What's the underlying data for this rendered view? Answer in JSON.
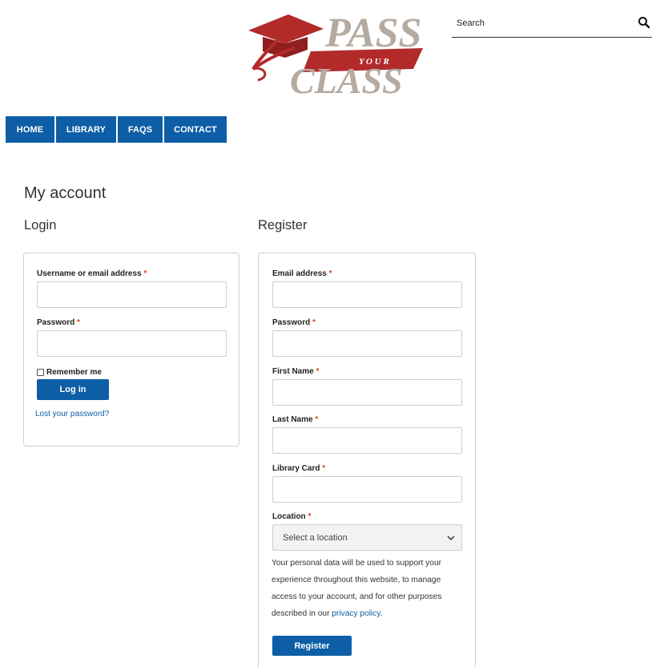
{
  "logo": {
    "line1": "PASS",
    "line2": "Y O U R",
    "line3": "CLASS"
  },
  "search": {
    "placeholder": "Search",
    "icon": "search-icon"
  },
  "nav": {
    "items": [
      {
        "label": "HOME"
      },
      {
        "label": "LIBRARY"
      },
      {
        "label": "FAQS"
      },
      {
        "label": "CONTACT"
      }
    ]
  },
  "page": {
    "title": "My account"
  },
  "login": {
    "heading": "Login",
    "username_label": "Username or email address",
    "password_label": "Password",
    "required_mark": "*",
    "remember_label": "Remember me",
    "login_button": "Log in",
    "lost_password": "Lost your password?"
  },
  "register": {
    "heading": "Register",
    "email_label": "Email address",
    "password_label": "Password",
    "first_name_label": "First Name",
    "last_name_label": "Last Name",
    "library_card_label": "Library Card",
    "location_label": "Location",
    "required_mark": "*",
    "location_placeholder": "Select a location",
    "privacy_text": "Your personal data will be used to support your experience throughout this website, to manage access to your account, and for other purposes described in our ",
    "privacy_link": "privacy policy",
    "privacy_end": ".",
    "register_button": "Register"
  },
  "colors": {
    "brand_blue": "#0d5ea6",
    "required_red": "#e2401c",
    "logo_red": "#b22a2a",
    "logo_gray": "#b5aaa0"
  }
}
